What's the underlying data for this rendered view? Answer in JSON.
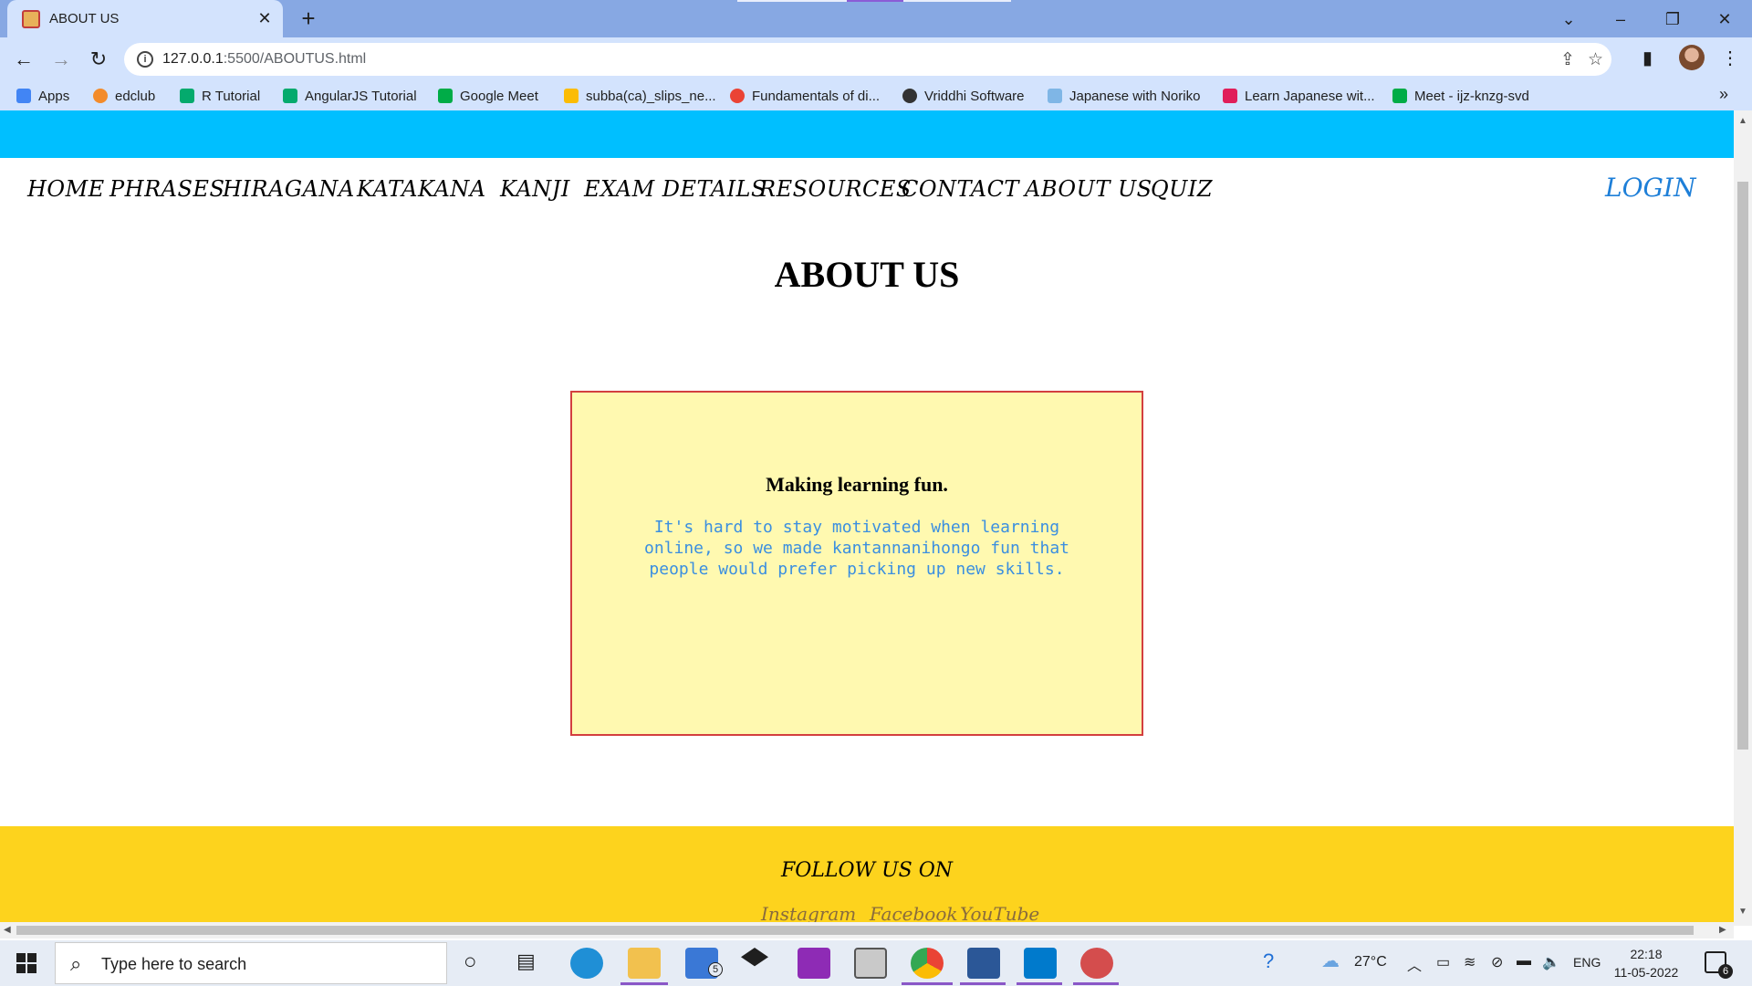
{
  "browser": {
    "tab_title": "ABOUT US",
    "url_host": "127.0.0.1",
    "url_path": ":5500/ABOUTUS.html",
    "bookmarks": [
      {
        "label": "Apps",
        "icon": "apps-grid-icon",
        "color": "#4285f4"
      },
      {
        "label": "edclub",
        "icon": "edclub-icon",
        "color": "#f38b2a"
      },
      {
        "label": "R Tutorial",
        "icon": "w3-icon",
        "color": "#04aa6d"
      },
      {
        "label": "AngularJS Tutorial",
        "icon": "w3-icon",
        "color": "#04aa6d"
      },
      {
        "label": "Google Meet",
        "icon": "meet-icon",
        "color": "#00ac47"
      },
      {
        "label": "subba(ca)_slips_ne...",
        "icon": "drive-icon",
        "color": "#fbbc04"
      },
      {
        "label": "Fundamentals of di...",
        "icon": "google-icon",
        "color": "#ea4335"
      },
      {
        "label": "Vriddhi Software",
        "icon": "globe-icon",
        "color": "#333333"
      },
      {
        "label": "Japanese with Noriko",
        "icon": "page-icon",
        "color": "#7fb6e6"
      },
      {
        "label": "Learn Japanese wit...",
        "icon": "slack-icon",
        "color": "#e01e5a"
      },
      {
        "label": "Meet - ijz-knzg-svd",
        "icon": "meet-icon",
        "color": "#00ac47"
      }
    ]
  },
  "site": {
    "nav": [
      "HOME",
      "PHRASES",
      "HIRAGANA",
      "KATAKANA",
      "KANJI",
      "EXAM DETAILS",
      "RESOURCES",
      "CONTACT",
      "ABOUT US",
      "QUIZ"
    ],
    "login": "LOGIN",
    "page_title": "ABOUT US",
    "card": {
      "heading": "Making learning fun.",
      "body": "It's hard to stay motivated when learning online, so we made kantannanihongo fun that people would prefer picking up new skills."
    },
    "footer": {
      "follow": "FOLLOW US ON",
      "links": [
        "Instagram",
        "Facebook",
        "YouTube"
      ]
    }
  },
  "taskbar": {
    "search_placeholder": "Type here to search",
    "mail_badge": "5",
    "temperature": "27°C",
    "language": "ENG",
    "time": "22:18",
    "date": "11-05-2022",
    "notifications": "6"
  },
  "colors": {
    "top_strip": "#00bfff",
    "card_bg": "#fff9b0",
    "card_border": "#d33f3f",
    "card_text": "#3b8fe0",
    "footer_bg": "#fdd31d",
    "login": "#1e7fd8"
  }
}
